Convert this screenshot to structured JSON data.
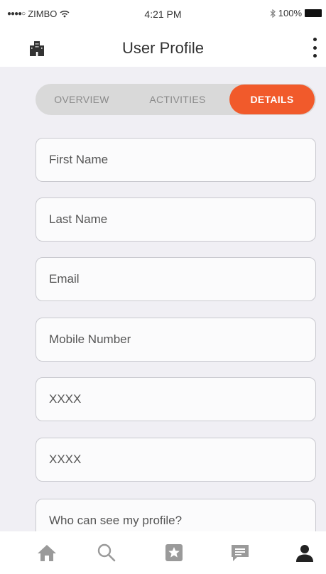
{
  "status_bar": {
    "carrier": "ZIMBO",
    "time": "4:21 PM",
    "battery_percent": "100%",
    "icons": [
      "signal-dots-icon",
      "wifi-icon",
      "bluetooth-icon",
      "battery-icon"
    ]
  },
  "nav_bar": {
    "title": "User Profile",
    "left_icon": "building-icon",
    "right_icon": "more-vertical-icon"
  },
  "segments": [
    {
      "label": "OVERVIEW",
      "active": false
    },
    {
      "label": "ACTIVITIES",
      "active": false
    },
    {
      "label": "DETAILS",
      "active": true
    }
  ],
  "form": {
    "fields": [
      {
        "label": "First Name"
      },
      {
        "label": "Last Name"
      },
      {
        "label": "Email"
      },
      {
        "label": "Mobile Number"
      },
      {
        "label": "XXXX"
      },
      {
        "label": "XXXX"
      },
      {
        "label": "Who can see my profile?"
      }
    ]
  },
  "tab_bar": {
    "icons": [
      "home-icon",
      "search-icon",
      "badge-icon",
      "chat-icon",
      "profile-icon"
    ],
    "active": "profile-icon"
  },
  "colors": {
    "accent": "#f15a2b",
    "content_bg": "#f0eff4",
    "segment_bg": "#d9d9d9",
    "icon_grey": "#9a9a9a",
    "icon_dark": "#222222"
  }
}
